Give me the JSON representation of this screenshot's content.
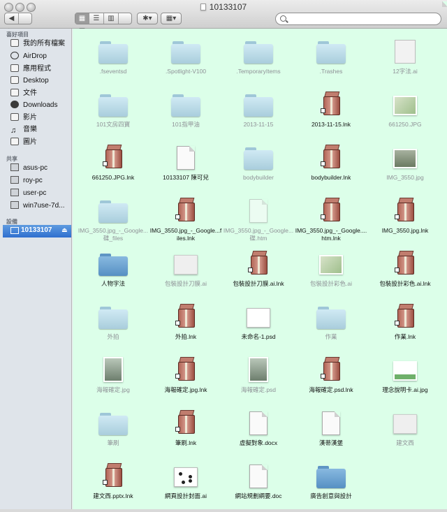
{
  "window": {
    "title": "10133107"
  },
  "toolbar": {
    "back": "◀",
    "forward": "▶",
    "view_icon": "▦",
    "view_list": "☰",
    "view_column": "▥",
    "view_coverflow": "▤",
    "action": "✱▾",
    "arrange": "▦▾",
    "search_placeholder": ""
  },
  "sidebar": {
    "favorites_header": "喜好項目",
    "favorites": [
      {
        "label": "我的所有檔案",
        "icon": "all-files-icon"
      },
      {
        "label": "AirDrop",
        "icon": "airdrop-icon"
      },
      {
        "label": "應用程式",
        "icon": "applications-icon"
      },
      {
        "label": "Desktop",
        "icon": "desktop-icon"
      },
      {
        "label": "文件",
        "icon": "documents-icon"
      },
      {
        "label": "Downloads",
        "icon": "downloads-icon"
      },
      {
        "label": "影片",
        "icon": "movies-icon"
      },
      {
        "label": "音樂",
        "icon": "music-icon"
      },
      {
        "label": "圖片",
        "icon": "pictures-icon"
      }
    ],
    "shared_header": "共享",
    "shared": [
      {
        "label": "asus-pc",
        "icon": "network-pc-icon"
      },
      {
        "label": "roy-pc",
        "icon": "network-pc-icon"
      },
      {
        "label": "user-pc",
        "icon": "network-pc-icon"
      },
      {
        "label": "win7use-7d...",
        "icon": "network-pc-icon"
      }
    ],
    "devices_header": "設備",
    "devices": [
      {
        "label": "10133107",
        "icon": "drive-icon",
        "selected": true,
        "eject": "⏏"
      }
    ]
  },
  "files": [
    {
      "name": ".fseventsd",
      "type": "folder",
      "muted": true
    },
    {
      "name": ".Spotlight-V100",
      "type": "folder",
      "muted": true
    },
    {
      "name": ".TemporaryItems",
      "type": "folder",
      "muted": true
    },
    {
      "name": ".Trashes",
      "type": "folder",
      "muted": true
    },
    {
      "name": "12字法.ai",
      "type": "ai",
      "muted": true
    },
    {
      "name": "101文房四寶",
      "type": "folder",
      "muted": true
    },
    {
      "name": "101指甲油",
      "type": "folder",
      "muted": true
    },
    {
      "name": "2013-11-15",
      "type": "folder",
      "muted": true
    },
    {
      "name": "2013-11-15.lnk",
      "type": "lnk",
      "muted": false
    },
    {
      "name": "661250.JPG",
      "type": "map",
      "muted": true
    },
    {
      "name": "661250.JPG.lnk",
      "type": "lnk",
      "muted": false
    },
    {
      "name": "10133107 陳可兒",
      "type": "docx",
      "muted": false
    },
    {
      "name": "bodybuilder",
      "type": "folder",
      "muted": true
    },
    {
      "name": "bodybuilder.lnk",
      "type": "lnk",
      "muted": false
    },
    {
      "name": "IMG_3550.jpg",
      "type": "photo",
      "muted": true
    },
    {
      "name": "IMG_3550.jpg_-_Google...碟_files",
      "type": "folder",
      "muted": true
    },
    {
      "name": "IMG_3550.jpg_-_Google...files.lnk",
      "type": "lnk",
      "muted": false
    },
    {
      "name": "IMG_3550.jpg_-_Google...碟.htm",
      "type": "htm",
      "muted": true
    },
    {
      "name": "IMG_3550.jpg_-_Google....htm.lnk",
      "type": "lnk",
      "muted": false
    },
    {
      "name": "IMG_3550.jpg.lnk",
      "type": "lnk",
      "muted": false
    },
    {
      "name": "人物字法",
      "type": "folder-dark",
      "muted": false
    },
    {
      "name": "包裝設計刀膜.ai",
      "type": "gray",
      "muted": true
    },
    {
      "name": "包裝設計刀膜.ai.lnk",
      "type": "lnk",
      "muted": false
    },
    {
      "name": "包裝設計彩色.ai",
      "type": "map",
      "muted": true
    },
    {
      "name": "包裝設計彩色.ai.lnk",
      "type": "lnk",
      "muted": false
    },
    {
      "name": "外拍",
      "type": "folder",
      "muted": true
    },
    {
      "name": "外拍.lnk",
      "type": "lnk",
      "muted": false
    },
    {
      "name": "未命名-1.psd",
      "type": "sheet",
      "muted": false
    },
    {
      "name": "作業",
      "type": "folder",
      "muted": true
    },
    {
      "name": "作業.lnk",
      "type": "lnk",
      "muted": false
    },
    {
      "name": "海報確定.jpg",
      "type": "poster",
      "muted": true
    },
    {
      "name": "海報確定.jpg.lnk",
      "type": "lnk",
      "muted": false
    },
    {
      "name": "海報確定.psd",
      "type": "poster",
      "muted": true
    },
    {
      "name": "海報確定.psd.lnk",
      "type": "lnk",
      "muted": false
    },
    {
      "name": "理念說明卡.ai.jpg",
      "type": "card",
      "muted": false
    },
    {
      "name": "筆刷",
      "type": "folder",
      "muted": true
    },
    {
      "name": "筆刷.lnk",
      "type": "lnk",
      "muted": false
    },
    {
      "name": "虛擬對象.docx",
      "type": "docx",
      "muted": false
    },
    {
      "name": "漢蒂漢堡",
      "type": "docx",
      "muted": false
    },
    {
      "name": "建文西",
      "type": "gray",
      "muted": true
    },
    {
      "name": "建文西.pptx.lnk",
      "type": "lnk",
      "muted": false
    },
    {
      "name": "網頁設計封面.ai",
      "type": "dots",
      "muted": false
    },
    {
      "name": "網站規劃綱要.doc",
      "type": "doc",
      "muted": false
    },
    {
      "name": "廣告創意與設計",
      "type": "folder-dark",
      "muted": false
    }
  ]
}
